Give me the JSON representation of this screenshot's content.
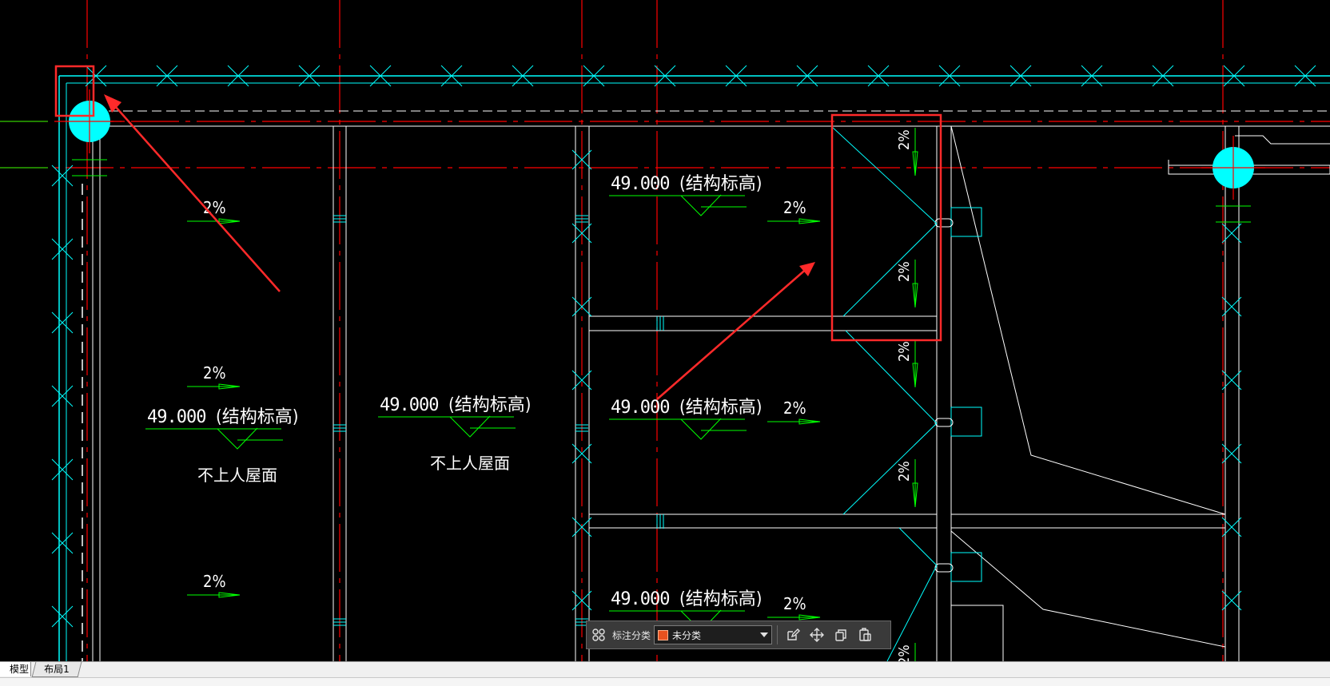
{
  "drawing": {
    "elevation_value": "49.000",
    "elevation_note": "(结构标高)",
    "slope": "2%",
    "roof_note": "不上人屋面"
  },
  "toolbar": {
    "category_label": "标注分类",
    "category_value": "未分类",
    "swatch_color": "#e8521f",
    "icons": [
      "grid-icon",
      "edit-icon",
      "move-icon",
      "copy-icon",
      "paste-icon"
    ]
  },
  "tabs": {
    "model": "模型",
    "layout1": "布局1"
  },
  "colors": {
    "background": "#000000",
    "wall_line": "#ffffff",
    "axis_line": "#ff0000",
    "hatch": "#00ffff",
    "slope_arrow": "#00ff00",
    "highlight": "#ff2a2a"
  }
}
